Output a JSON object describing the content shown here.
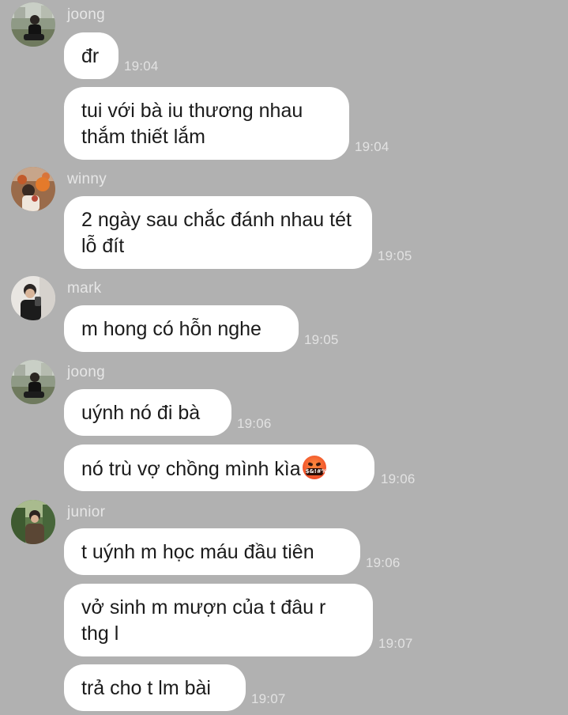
{
  "messages": [
    {
      "sender": "joong",
      "text": "đr",
      "time": "19:04"
    },
    {
      "text": "tui với bà iu thương nhau thắm thiết lắm",
      "time": "19:04"
    },
    {
      "sender": "winny",
      "text": "2 ngày sau chắc đánh nhau tét lỗ đít",
      "time": "19:05"
    },
    {
      "sender": "mark",
      "text": "m hong có hỗn nghe",
      "time": "19:05"
    },
    {
      "sender": "joong",
      "text": "uýnh nó đi bà",
      "time": "19:06"
    },
    {
      "text": "nó trù vợ chồng mình kìa",
      "emoji": "face-with-symbols-on-mouth",
      "emoji_text": "$&!#%",
      "time": "19:06"
    },
    {
      "sender": "junior",
      "text": "t uýnh m học máu đầu tiên",
      "time": "19:06"
    },
    {
      "text": "vở sinh m mượn của t đâu r thg l",
      "time": "19:07"
    },
    {
      "text": "trả cho t lm bài",
      "time": "19:07"
    }
  ],
  "colors": {
    "background": "#b1b1b1",
    "bubble": "#ffffff",
    "text": "#1b1b1b",
    "meta_text": "#e6e6e6"
  }
}
